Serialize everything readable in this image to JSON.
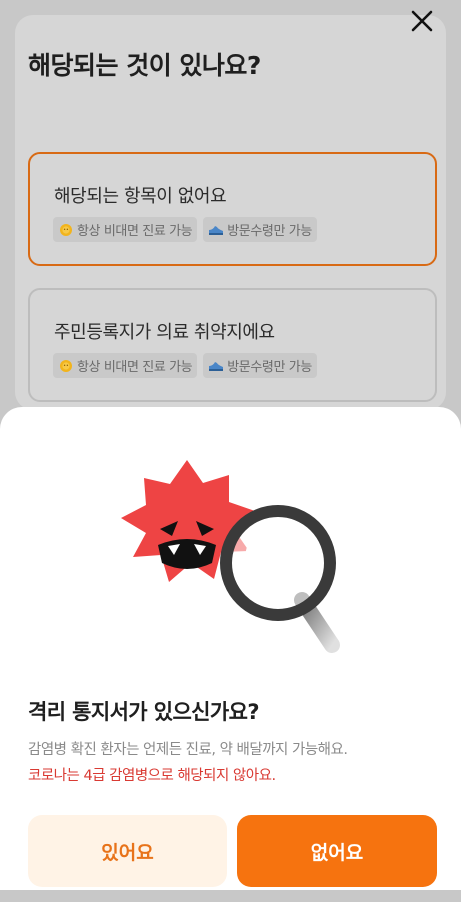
{
  "page": {
    "title": "해당되는 것이 있나요?"
  },
  "options": [
    {
      "title": "해당되는 항목이 없어요",
      "selected": true,
      "tags": [
        {
          "icon": "sun-icon",
          "label": "항상 비대면 진료 가능"
        },
        {
          "icon": "shoe-icon",
          "label": "방문수령만 가능"
        }
      ]
    },
    {
      "title": "주민등록지가 의료 취약지에요",
      "selected": false,
      "tags": [
        {
          "icon": "sun-icon",
          "label": "항상 비대면 진료 가능"
        },
        {
          "icon": "shoe-icon",
          "label": "방문수령만 가능"
        }
      ]
    }
  ],
  "sheet": {
    "illustration": "virus-magnifier-illustration",
    "title": "격리 통지서가 있으신가요?",
    "description": "감염병 확진 환자는 언제든 진료, 약 배달까지 가능해요.",
    "warning": "코로나는 4급 감염병으로 해당되지 않아요.",
    "buttons": {
      "yes": "있어요",
      "no": "없어요"
    }
  },
  "colors": {
    "accent": "#f6730f",
    "accent_soft": "#fff3e6",
    "warning": "#d93a33",
    "selected_border": "#d86a14",
    "virus": "#ee4444"
  }
}
